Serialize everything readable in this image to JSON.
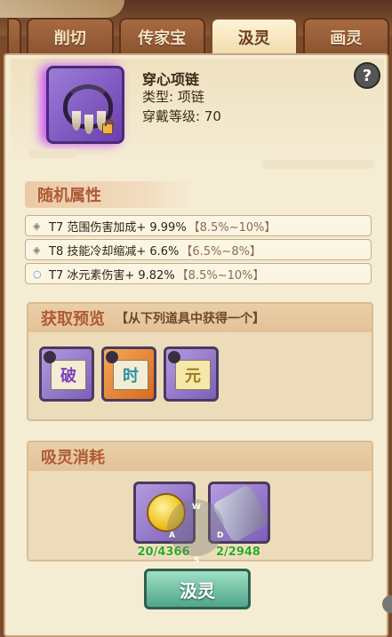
{
  "tabs": [
    "削切",
    "传家宝",
    "汲灵",
    "画灵"
  ],
  "item": {
    "name": "穿心项链",
    "type_line": "类型: 项链",
    "level_line": "穿戴等级: 70"
  },
  "help_icon": "?",
  "random_attrs": {
    "title": "随机属性",
    "rows": [
      {
        "text": "T7 范围伤害加成+ 9.99%",
        "range": "【8.5%~10%】"
      },
      {
        "text": "T8 技能冷却缩减+ 6.6%",
        "range": "【6.5%~8%】"
      },
      {
        "text": "T7 冰元素伤害+ 9.82%",
        "range": "【8.5%~10%】"
      }
    ]
  },
  "preview": {
    "title": "获取预览",
    "subtitle": "【从下列道具中获得一个】",
    "items": [
      "破",
      "时",
      "元"
    ]
  },
  "consume": {
    "title": "吸灵消耗",
    "counts": [
      "20/4366",
      "2/2948"
    ]
  },
  "joystick": {
    "w": "W",
    "a": "A",
    "s": "S",
    "d": "D"
  },
  "action_label": "汲灵",
  "colors": {
    "accent": "#b05a36",
    "count_green": "#2ea81f",
    "button": "#4fa58a"
  }
}
